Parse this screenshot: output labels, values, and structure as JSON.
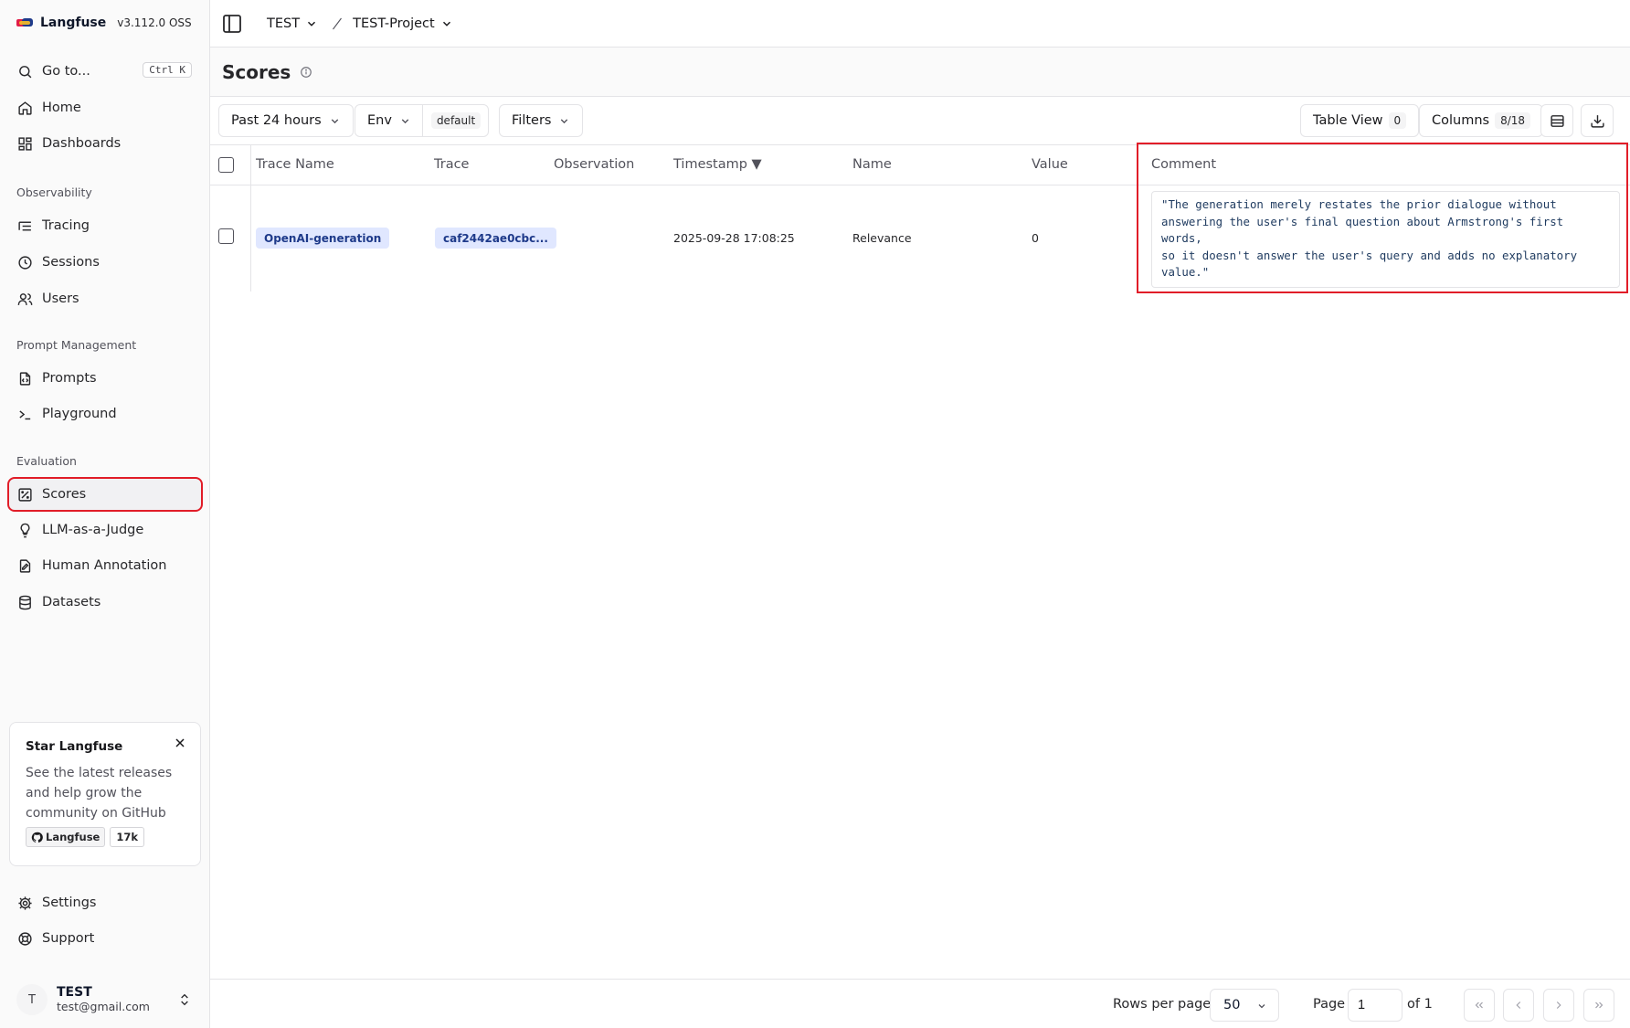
{
  "app": {
    "name": "Langfuse",
    "version": "v3.112.0 OSS"
  },
  "sidebar": {
    "goto": {
      "label": "Go to...",
      "shortcut": "Ctrl K"
    },
    "top_items": [
      {
        "label": "Home",
        "icon": "home-icon"
      },
      {
        "label": "Dashboards",
        "icon": "dashboard-icon"
      }
    ],
    "sections": {
      "observability": "Observability",
      "prompt_management": "Prompt Management",
      "evaluation": "Evaluation"
    },
    "observability_items": [
      {
        "label": "Tracing",
        "icon": "tracing-icon"
      },
      {
        "label": "Sessions",
        "icon": "clock-icon"
      },
      {
        "label": "Users",
        "icon": "users-icon"
      }
    ],
    "prompt_items": [
      {
        "label": "Prompts",
        "icon": "file-code-icon"
      },
      {
        "label": "Playground",
        "icon": "terminal-icon"
      }
    ],
    "evaluation_items": [
      {
        "label": "Scores",
        "icon": "scores-icon",
        "active": true
      },
      {
        "label": "LLM-as-a-Judge",
        "icon": "lightbulb-icon"
      },
      {
        "label": "Human Annotation",
        "icon": "annotation-icon"
      },
      {
        "label": "Datasets",
        "icon": "database-icon"
      }
    ],
    "star_card": {
      "title": "Star Langfuse",
      "text": "See the latest releases and help grow the community on GitHub",
      "badge_label": "Langfuse",
      "badge_count": "17k"
    },
    "bottom_items": [
      {
        "label": "Settings",
        "icon": "gear-icon"
      },
      {
        "label": "Support",
        "icon": "lifebuoy-icon"
      }
    ],
    "user": {
      "initial": "T",
      "name": "TEST",
      "email": "test@gmail.com"
    }
  },
  "topbar": {
    "org": "TEST",
    "project": "TEST-Project"
  },
  "page": {
    "title": "Scores"
  },
  "toolbar": {
    "time_range": "Past 24 hours",
    "env_label": "Env",
    "env_value": "default",
    "filters": "Filters",
    "table_view": "Table View",
    "table_view_count": "0",
    "columns": "Columns",
    "columns_count": "8/18"
  },
  "table": {
    "headers": {
      "trace_name": "Trace Name",
      "trace": "Trace",
      "observation": "Observation",
      "timestamp": "Timestamp ▼",
      "name": "Name",
      "value": "Value",
      "comment": "Comment"
    },
    "rows": [
      {
        "trace_name": "OpenAI-generation",
        "trace": "caf2442ae0cbc...",
        "observation": "",
        "timestamp": "2025-09-28 17:08:25",
        "name": "Relevance",
        "value": "0",
        "comment": "\"The generation merely restates the prior dialogue without\nanswering the user's final question about Armstrong's first words,\nso it doesn't answer the user's query and adds no explanatory\nvalue.\""
      }
    ]
  },
  "footer": {
    "rows_per_page_label": "Rows per page",
    "rows_per_page": "50",
    "page_label": "Page",
    "page_value": "1",
    "of_label": "of 1"
  },
  "colors": {
    "accent_red": "#e11d28",
    "chip_bg": "#e0e7ff",
    "chip_text": "#1e3a8a"
  }
}
